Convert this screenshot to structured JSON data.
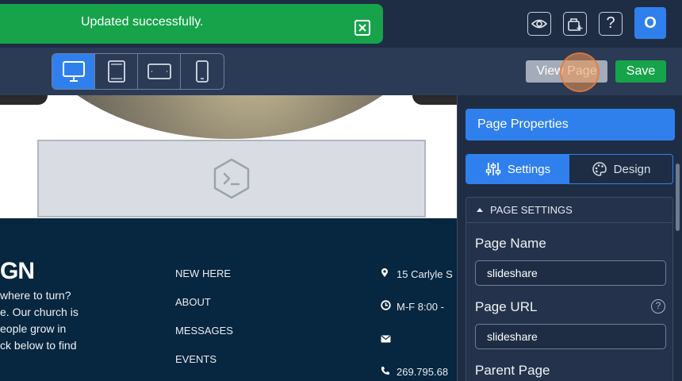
{
  "toast": {
    "message": "Updated successfully."
  },
  "toolbar": {
    "view_page_label": "View Page",
    "save_label": "Save",
    "help_label": "?",
    "avatar_initial": "O"
  },
  "footer": {
    "brand": "GN",
    "about_lines": [
      " where to turn?",
      "e. Our church is",
      "eople grow in",
      "ck below to find"
    ],
    "nav": [
      "NEW HERE",
      "ABOUT",
      "MESSAGES",
      "EVENTS"
    ],
    "contact": {
      "address": "15 Carlyle S",
      "hours": "M-F 8:00 -",
      "email": "",
      "phone": "269.795.68"
    }
  },
  "panel": {
    "title": "Page Properties",
    "tabs": [
      {
        "label": "Settings",
        "icon": "sliders-icon",
        "active": true
      },
      {
        "label": "Design",
        "icon": "palette-icon",
        "active": false
      }
    ],
    "section_title": "PAGE SETTINGS",
    "fields": {
      "page_name": {
        "label": "Page Name",
        "value": "slideshare"
      },
      "page_url": {
        "label": "Page URL",
        "value": "slideshare",
        "help": "?"
      },
      "parent_page": {
        "label": "Parent Page"
      }
    }
  },
  "colors": {
    "topbar": "#1f2d44",
    "accent": "#2f80ed",
    "success": "#16a34a",
    "footer": "#07263f"
  }
}
